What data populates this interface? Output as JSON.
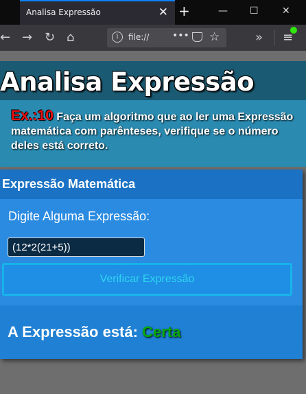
{
  "browser": {
    "tab_title": "Analisa Expressão",
    "tab_close": "✕",
    "new_tab": "+",
    "url": "file://",
    "url_dots": "•••",
    "window_minimize": "—",
    "window_maximize": "☐",
    "window_close": "✕",
    "overflow": "»",
    "menu": "≡"
  },
  "page": {
    "title": "Analisa Expressão",
    "exercise_label": "Ex.:10",
    "description": " Faça um algoritmo que ao ler uma Expressão matemática com parênteses, verifique se o número deles está correto."
  },
  "card": {
    "title": "Expressão Matemática",
    "input_label": "Digite Alguma Expressão:",
    "input_value": "(12*2(21+5))",
    "button_label": "Verificar Expressão",
    "result_label": "A Expressão está:",
    "result_value": "Certa"
  },
  "colors": {
    "header": "#1b5a73",
    "description_band": "#2a8ab0",
    "card": "#2a8be0",
    "card_header": "#1b72c4",
    "exercise_label": "#e81010",
    "result_ok": "#07a80a",
    "button_text": "#2fd6ef"
  }
}
